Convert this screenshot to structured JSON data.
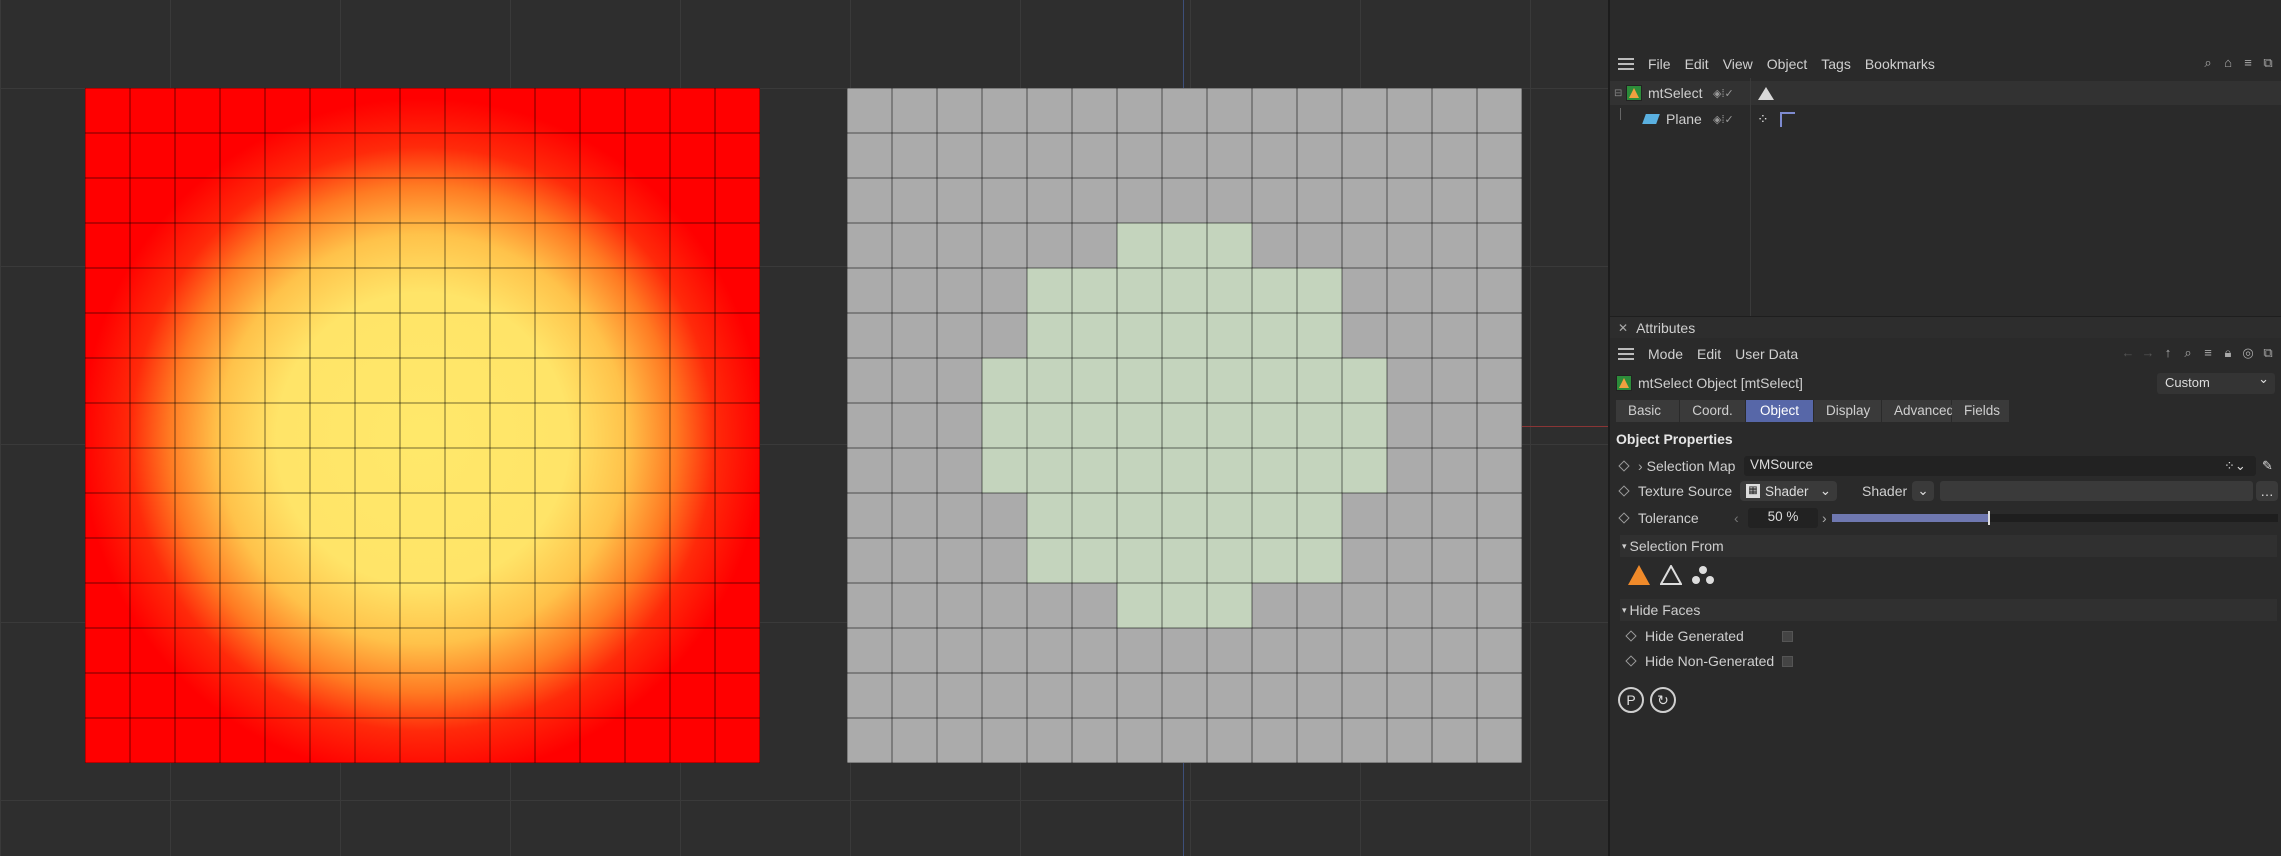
{
  "object_manager": {
    "menu": [
      "File",
      "Edit",
      "View",
      "Object",
      "Tags",
      "Bookmarks"
    ],
    "objects": [
      {
        "name": "mtSelect",
        "icon": "mtselect-icon"
      },
      {
        "name": "Plane",
        "icon": "plane-icon"
      }
    ]
  },
  "attributes": {
    "panel_title": "Attributes",
    "menu": [
      "Mode",
      "Edit",
      "User Data"
    ],
    "object_header": "mtSelect Object [mtSelect]",
    "layout_dropdown": "Custom",
    "tabs": [
      "Basic",
      "Coord.",
      "Object",
      "Display",
      "Advanced",
      "Fields"
    ],
    "active_tab": "Object",
    "section_title": "Object Properties",
    "selection_map": {
      "label": "Selection Map",
      "value": "VMSource"
    },
    "texture_source": {
      "label": "Texture Source",
      "value": "Shader",
      "shader_label": "Shader"
    },
    "tolerance": {
      "label": "Tolerance",
      "value": "50 %",
      "fraction": 0.5
    },
    "selection_from": {
      "title": "Selection From"
    },
    "hide_faces": {
      "title": "Hide Faces",
      "hide_generated": "Hide Generated",
      "hide_non_generated": "Hide Non-Generated"
    }
  },
  "colors": {
    "accent_tab": "#5767a8",
    "heat_center": "#ffe86a",
    "heat_edge": "#ff0000",
    "selection_green": "#c4d4bd",
    "plane_gray": "#ababab"
  }
}
